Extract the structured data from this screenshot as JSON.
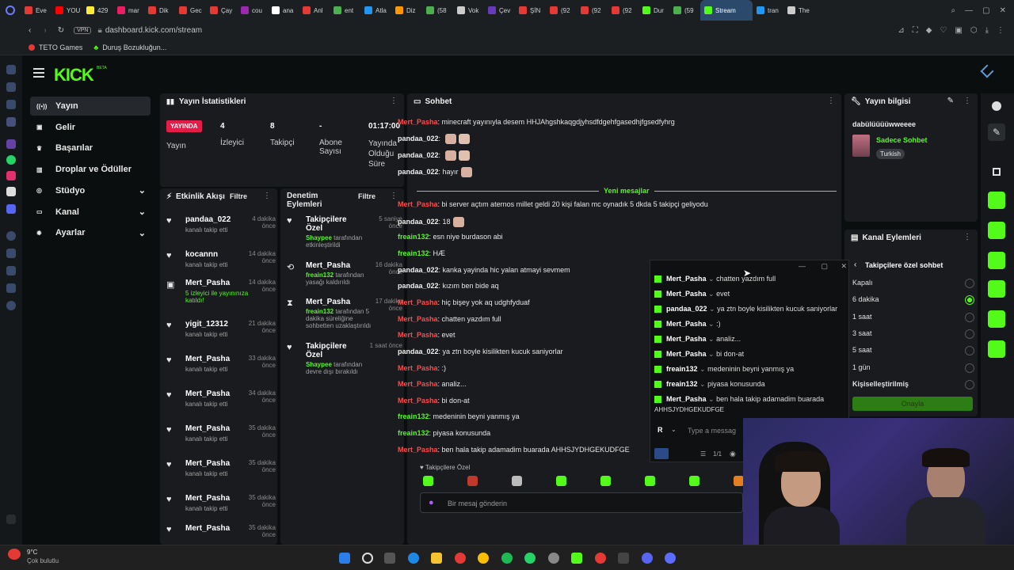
{
  "browser": {
    "tabs": [
      "Eve",
      "YOU",
      "429",
      "mar",
      "Dik",
      "Gec",
      "Çay",
      "cou",
      "ana",
      "Anl",
      "ent",
      "Atla",
      "Diz",
      "(58",
      "Vok",
      "Çev",
      "ŞİN",
      "(92",
      "(92",
      "(92",
      "Dur",
      "(59",
      "Stream",
      "tran",
      "The"
    ],
    "active_tab": "Stream",
    "url": "dashboard.kick.com/stream",
    "vpn": "VPN",
    "bookmarks": [
      "TETO Games",
      "Duruş Bozukluğun..."
    ]
  },
  "nav": {
    "logo": "KICK",
    "beta": "BETA",
    "items": [
      {
        "label": "Yayın",
        "icon": "broadcast-icon"
      },
      {
        "label": "Gelir",
        "icon": "money-icon"
      },
      {
        "label": "Başarılar",
        "icon": "trophy-icon"
      },
      {
        "label": "Droplar ve Ödüller",
        "icon": "gift-icon"
      },
      {
        "label": "Stüdyo",
        "icon": "camera-icon"
      },
      {
        "label": "Kanal",
        "icon": "tv-icon"
      },
      {
        "label": "Ayarlar",
        "icon": "gear-icon"
      }
    ]
  },
  "stats": {
    "title": "Yayın İstatistikleri",
    "live_badge": "YAYINDA",
    "live_label": "Yayın",
    "viewers_value": "4",
    "viewers_label": "İzleyici",
    "followers_value": "8",
    "followers_label": "Takipçi",
    "subs_value": "-",
    "subs_label": "Abone Sayısı",
    "duration_value": "01:17:00",
    "duration_label": "Yayında Olduğu Süre"
  },
  "activity": {
    "title": "Etkinlik Akışı",
    "filter": "Filtre",
    "items": [
      {
        "name": "pandaa_022",
        "sub": "kanalı takip etti",
        "time": "4 dakika önce"
      },
      {
        "name": "kocannn",
        "sub": "kanalı takip etti",
        "time": "14 dakika önce"
      },
      {
        "name": "Mert_Pasha",
        "sub": "5 izleyici ile yayınınıza katıldı!",
        "time": "14 dakika önce"
      },
      {
        "name": "yigit_12312",
        "sub": "kanalı takip etti",
        "time": "21 dakika önce"
      },
      {
        "name": "Mert_Pasha",
        "sub": "kanalı takip etti",
        "time": "33 dakika önce"
      },
      {
        "name": "Mert_Pasha",
        "sub": "kanalı takip etti",
        "time": "34 dakika önce"
      },
      {
        "name": "Mert_Pasha",
        "sub": "kanalı takip etti",
        "time": "35 dakika önce"
      },
      {
        "name": "Mert_Pasha",
        "sub": "kanalı takip etti",
        "time": "35 dakika önce"
      },
      {
        "name": "Mert_Pasha",
        "sub": "kanalı takip etti",
        "time": "35 dakika önce"
      },
      {
        "name": "Mert_Pasha",
        "sub": "",
        "time": "35 dakika önce"
      }
    ]
  },
  "moderation": {
    "title": "Denetim Eylemleri",
    "filter": "Filtre",
    "items": [
      {
        "name": "Takipçilere Özel",
        "sub_user": "Shaypee",
        "sub": "tarafından etkinleştirildi",
        "time": "5 saniye önce"
      },
      {
        "name": "Mert_Pasha",
        "sub_user": "freain132",
        "sub": "tarafından yasağı kaldırıldı",
        "time": "16 dakika önce"
      },
      {
        "name": "Mert_Pasha",
        "sub_user": "freain132",
        "sub": "tarafından 5 dakika süreliğine sohbetten uzaklaştırıldı",
        "time": "17 dakika önce"
      },
      {
        "name": "Takipçilere Özel",
        "sub_user": "Shaypee",
        "sub": "tarafından devre dışı bırakıldı",
        "time": "1 saat önce"
      }
    ]
  },
  "chat": {
    "title": "Sohbet",
    "new_messages": "Yeni mesajlar",
    "messages_before": [
      {
        "user": "Mert_Pasha",
        "color": "red",
        "text": "minecraft yayınıyla desem HHJAhgshkaqgdjyhsdfdgehfgasedhjfgsedfyhrg",
        "emotes": 0
      },
      {
        "user": "pandaa_022",
        "color": "white",
        "text": "",
        "emotes": 2
      },
      {
        "user": "pandaa_022",
        "color": "white",
        "text": "",
        "emotes": 2
      },
      {
        "user": "pandaa_022",
        "color": "white",
        "text": "hayır",
        "emotes": 1
      }
    ],
    "messages_after": [
      {
        "user": "Mert_Pasha",
        "color": "red",
        "text": "bi server açtım aternos millet geldi 20 kişi falan mc oynadık 5 dkda 5 takipçi geliyodu"
      },
      {
        "user": "pandaa_022",
        "color": "white",
        "text": "18"
      },
      {
        "user": "freain132",
        "color": "green",
        "text": "esn niye burdason abi"
      },
      {
        "user": "freain132",
        "color": "green",
        "text": "HÆ"
      },
      {
        "user": "pandaa_022",
        "color": "white",
        "text": "kanka yayinda hic yalan atmayi sevmem"
      },
      {
        "user": "pandaa_022",
        "color": "white",
        "text": "kızım ben bide aq"
      },
      {
        "user": "Mert_Pasha",
        "color": "red",
        "text": "hiç bişey yok aq udghfyduaf"
      },
      {
        "user": "Mert_Pasha",
        "color": "red",
        "text": "chatten yazdım full"
      },
      {
        "user": "Mert_Pasha",
        "color": "red",
        "text": "evet"
      },
      {
        "user": "pandaa_022",
        "color": "white",
        "text": "ya ztn boyle kisilikten kucuk saniyorlar"
      },
      {
        "user": "Mert_Pasha",
        "color": "red",
        "text": ":)"
      },
      {
        "user": "Mert_Pasha",
        "color": "red",
        "text": "analiz..."
      },
      {
        "user": "Mert_Pasha",
        "color": "red",
        "text": "bi don-at"
      },
      {
        "user": "freain132",
        "color": "green",
        "text": "medeninin beyni yanmış ya"
      },
      {
        "user": "freain132",
        "color": "green",
        "text": "piyasa konusunda"
      },
      {
        "user": "Mert_Pasha",
        "color": "red",
        "text": "ben hala takip adamadim buarada AHHSJYDHGEKUDFGE"
      }
    ],
    "mode_label": "Takipçilere Özel",
    "input_placeholder": "Bir mesaj gönderin"
  },
  "popout": {
    "rows": [
      {
        "user": "Mert_Pasha",
        "text": "chatten yazdım full"
      },
      {
        "user": "Mert_Pasha",
        "text": "evet"
      },
      {
        "user": "pandaa_022",
        "text": "ya ztn boyle kisilikten kucuk saniyorlar"
      },
      {
        "user": "Mert_Pasha",
        "text": ":)"
      },
      {
        "user": "Mert_Pasha",
        "text": "analiz..."
      },
      {
        "user": "Mert_Pasha",
        "text": "bi don-at"
      },
      {
        "user": "freain132",
        "text": "medeninin beyni yanmış ya"
      },
      {
        "user": "freain132",
        "text": "piyasa konusunda"
      },
      {
        "user": "Mert_Pasha",
        "text": "ben hala takip adamadim buarada"
      }
    ],
    "wrap_text": "AHHSJYDHGEKUDFGE",
    "placeholder": "Type a messag",
    "counter": "1/1"
  },
  "stream_info": {
    "title": "Yayın bilgisi",
    "stream_title": "dabülüüüüwweeee",
    "category": "Sadece Sohbet",
    "language": "Turkish"
  },
  "channel_actions": {
    "title": "Kanal Eylemleri",
    "sub_title": "Takipçilere özel sohbet",
    "options": [
      "Kapalı",
      "6 dakika",
      "1 saat",
      "3 saat",
      "5 saat",
      "1 gün",
      "Kişiselleştirilmiş"
    ],
    "selected_index": 1,
    "confirm": "Onayla"
  },
  "taskbar": {
    "weather_temp": "9°C",
    "weather_desc": "Çok bulutlu"
  },
  "colors": {
    "kick_green": "#53fc18",
    "live_red": "#e11d48",
    "user_red": "#ff4b4b",
    "panel": "#191b1f"
  }
}
